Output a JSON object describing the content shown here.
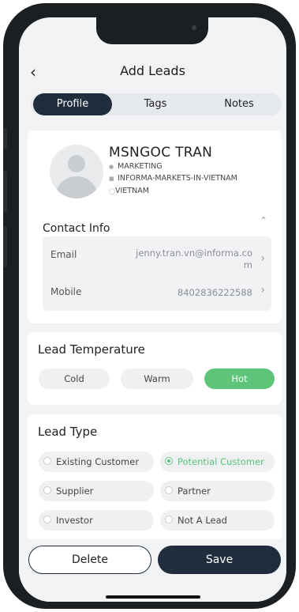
{
  "header": {
    "back_icon": "chevron-left-icon",
    "title": "Add Leads"
  },
  "tabs": [
    {
      "label": "Profile",
      "active": true
    },
    {
      "label": "Tags",
      "active": false
    },
    {
      "label": "Notes",
      "active": false
    }
  ],
  "profile": {
    "name": "MSNGOC TRAN",
    "department": "MARKETING",
    "company": "INFORMA-MARKETS-IN-VIETNAM",
    "country": "VIETNAM"
  },
  "contact": {
    "title": "Contact Info",
    "email_label": "Email",
    "email_value_line1": "jenny.tran.vn@informa.co",
    "email_value_line2": "m",
    "mobile_label": "Mobile",
    "mobile_value": "8402836222588"
  },
  "temperature": {
    "title": "Lead Temperature",
    "options": [
      "Cold",
      "Warm",
      "Hot"
    ],
    "selected": "Hot"
  },
  "lead_type": {
    "title": "Lead Type",
    "options": [
      "Existing Customer",
      "Potential Customer",
      "Supplier",
      "Partner",
      "Investor",
      "Not A Lead"
    ],
    "selected": "Potential Customer"
  },
  "actions": {
    "delete_label": "Delete",
    "save_label": "Save"
  },
  "colors": {
    "primary": "#1f2d3d",
    "accent": "#5dc47a"
  }
}
